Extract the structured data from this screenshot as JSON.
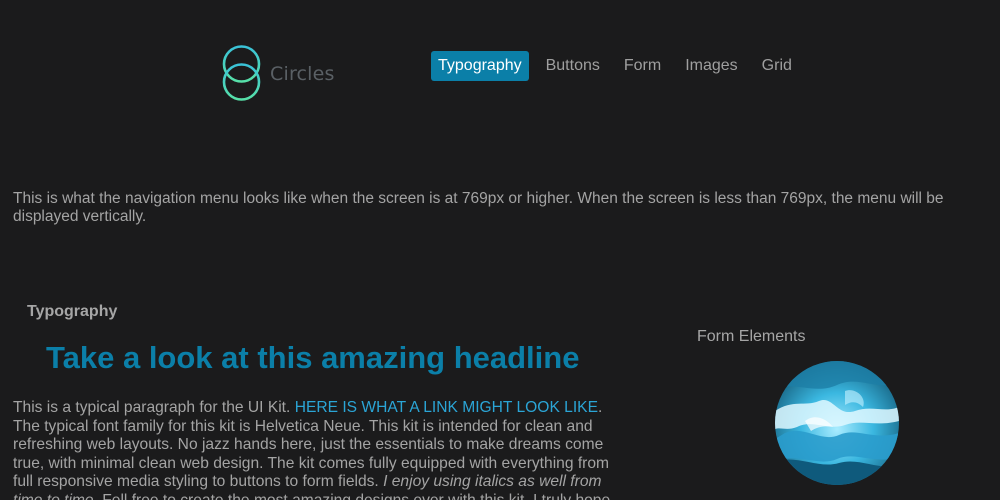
{
  "logo": {
    "text": "Circles",
    "icon": "interlocking-circles-logo"
  },
  "nav": {
    "items": [
      {
        "label": "Typography",
        "active": true
      },
      {
        "label": "Buttons",
        "active": false
      },
      {
        "label": "Form",
        "active": false
      },
      {
        "label": "Images",
        "active": false
      },
      {
        "label": "Grid",
        "active": false
      }
    ]
  },
  "info_text": "This is what the navigation menu looks like when the screen is at 769px or higher. When the screen is less than 769px, the menu will be displayed vertically.",
  "typography": {
    "section_label": "Typography",
    "headline": "Take a look at this amazing headline",
    "paragraph": {
      "lead": "This is a typical paragraph for the UI Kit. ",
      "link": "HERE IS WHAT A LINK MIGHT LOOK LIKE",
      "after_link": ". The typical font family for this kit is Helvetica Neue. This kit is intended for clean and refreshing web layouts. No jazz hands here, just the essentials to make dreams come true, with minimal clean web design. The kit comes fully equipped with everything from full responsive media styling to buttons to form fields. ",
      "italic": "I enjoy using italics as well from time to time",
      "tail": ". Fell free to create the most amazing designs ever with this kit. I truly hope"
    }
  },
  "form_elements": {
    "label": "Form Elements",
    "image": "ocean-wave-circle-image"
  },
  "colors": {
    "background": "#1b1b1c",
    "accent": "#0b7fa8",
    "link": "#2ba5d6",
    "logo_ring": "#3fd1b8"
  }
}
